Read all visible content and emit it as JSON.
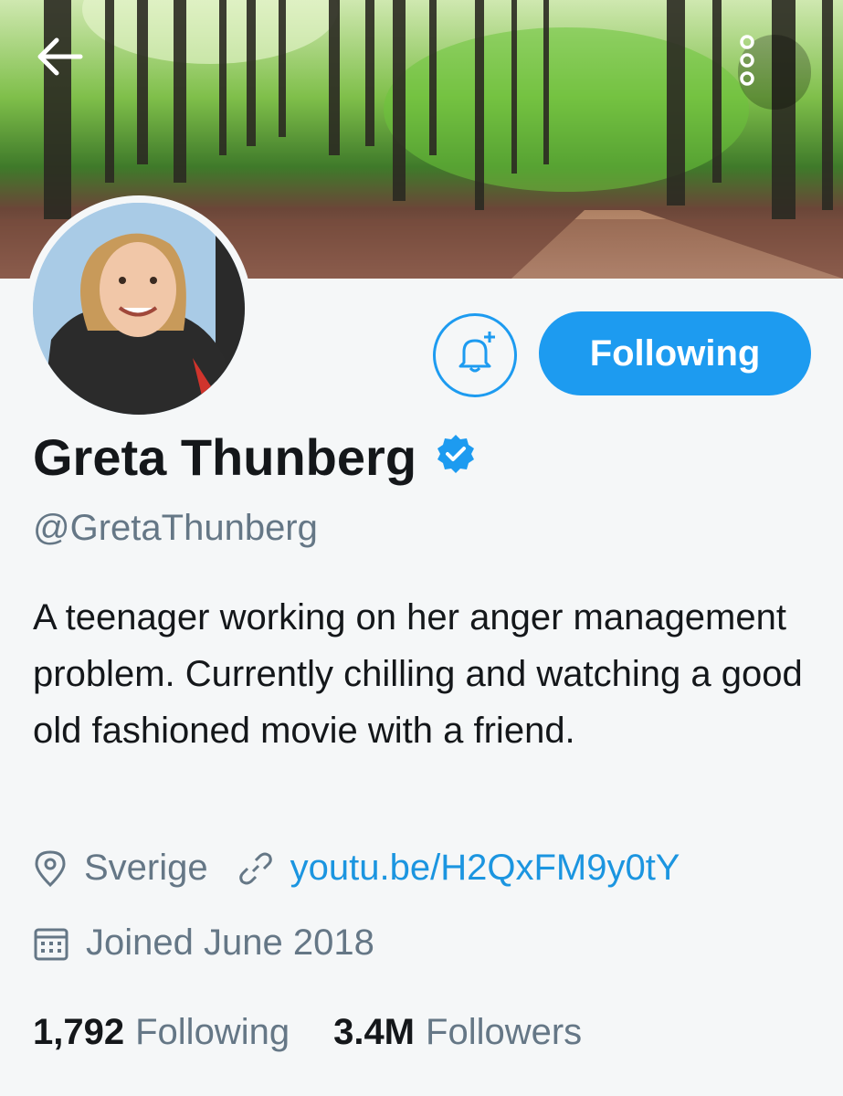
{
  "profile": {
    "name": "Greta Thunberg",
    "handle": "@GretaThunberg",
    "bio": "A teenager working on her anger management problem. Currently chilling and watching a good old fashioned movie with a friend.",
    "location": "Sverige",
    "link": "youtu.be/H2QxFM9y0tY",
    "joined": "Joined June 2018",
    "verified": true
  },
  "actions": {
    "follow_label": "Following"
  },
  "stats": {
    "following_count": "1,792",
    "following_label": "Following",
    "followers_count": "3.4M",
    "followers_label": "Followers"
  },
  "icons": {
    "back": "back-arrow-icon",
    "more": "more-vertical-icon",
    "bell": "bell-plus-icon",
    "verified": "verified-badge-icon",
    "location": "location-pin-icon",
    "link": "link-icon",
    "calendar": "calendar-icon"
  },
  "colors": {
    "accent": "#1d9bf0",
    "text": "#14171a",
    "muted": "#657786",
    "link": "#1b95e0"
  }
}
